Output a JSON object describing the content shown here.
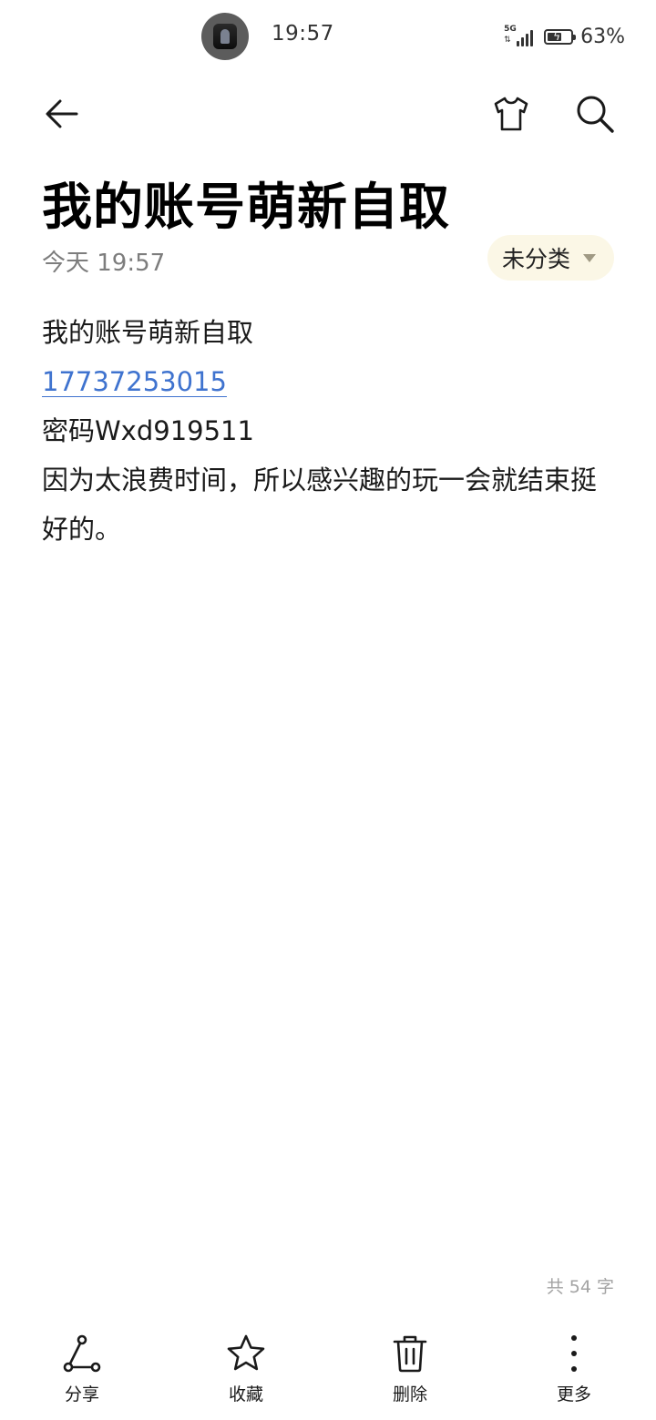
{
  "status_bar": {
    "time": "19:57",
    "network": "5G",
    "battery_text": "63%",
    "battery_level": 0.63
  },
  "top_bar": {
    "back_icon": "arrow-left-icon",
    "theme_icon": "tshirt-icon",
    "search_icon": "search-icon"
  },
  "note": {
    "title": "我的账号萌新自取",
    "date": "今天 19:57",
    "category": "未分类",
    "lines": [
      "我的账号萌新自取",
      "17737253015",
      "密码Wxd919511",
      "因为太浪费时间，所以感兴趣的玩一会就结束挺好的。"
    ],
    "char_count": "共 54 字"
  },
  "toolbar": {
    "share_label": "分享",
    "favorite_label": "收藏",
    "delete_label": "删除",
    "more_label": "更多"
  }
}
